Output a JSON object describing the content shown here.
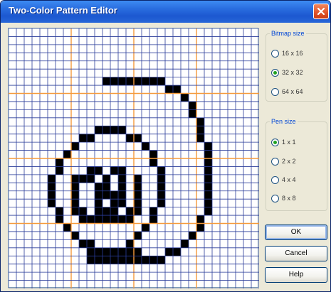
{
  "window": {
    "title": "Two-Color Pattern Editor"
  },
  "bitmap_size": {
    "label": "Bitmap size",
    "options": [
      "16 x 16",
      "32 x 32",
      "64 x 64"
    ],
    "selected": "32 x 32"
  },
  "pen_size": {
    "label": "Pen size",
    "options": [
      "1 x 1",
      "2 x 2",
      "4 x 4",
      "8 x 8"
    ],
    "selected": "1 x 1"
  },
  "buttons": {
    "ok": "OK",
    "cancel": "Cancel",
    "help": "Help"
  },
  "grid": {
    "columns": 32,
    "rows": 32,
    "line_color": "#2a3c9a",
    "guide_color": "#f59a3b",
    "guide_columns": [
      8,
      16,
      24
    ],
    "guide_rows": [
      8,
      16,
      24
    ],
    "pixel_color": "#000000",
    "background": "#ffffff",
    "filled_pixels": [
      [
        12,
        6
      ],
      [
        13,
        6
      ],
      [
        14,
        6
      ],
      [
        15,
        6
      ],
      [
        16,
        6
      ],
      [
        17,
        6
      ],
      [
        18,
        6
      ],
      [
        19,
        6
      ],
      [
        20,
        7
      ],
      [
        21,
        7
      ],
      [
        22,
        8
      ],
      [
        23,
        9
      ],
      [
        23,
        10
      ],
      [
        24,
        11
      ],
      [
        24,
        12
      ],
      [
        24,
        13
      ],
      [
        25,
        14
      ],
      [
        25,
        15
      ],
      [
        25,
        16
      ],
      [
        25,
        17
      ],
      [
        25,
        18
      ],
      [
        25,
        19
      ],
      [
        25,
        20
      ],
      [
        25,
        21
      ],
      [
        25,
        22
      ],
      [
        24,
        23
      ],
      [
        24,
        24
      ],
      [
        23,
        25
      ],
      [
        22,
        26
      ],
      [
        20,
        27
      ],
      [
        21,
        27
      ],
      [
        17,
        28
      ],
      [
        18,
        28
      ],
      [
        19,
        28
      ],
      [
        11,
        12
      ],
      [
        12,
        12
      ],
      [
        13,
        12
      ],
      [
        14,
        12
      ],
      [
        9,
        13
      ],
      [
        10,
        13
      ],
      [
        15,
        13
      ],
      [
        16,
        13
      ],
      [
        8,
        14
      ],
      [
        17,
        14
      ],
      [
        7,
        15
      ],
      [
        18,
        15
      ],
      [
        6,
        16
      ],
      [
        18,
        16
      ],
      [
        6,
        17
      ],
      [
        19,
        17
      ],
      [
        5,
        18
      ],
      [
        19,
        18
      ],
      [
        5,
        19
      ],
      [
        19,
        19
      ],
      [
        5,
        20
      ],
      [
        19,
        20
      ],
      [
        5,
        21
      ],
      [
        19,
        21
      ],
      [
        6,
        22
      ],
      [
        18,
        22
      ],
      [
        6,
        23
      ],
      [
        18,
        23
      ],
      [
        7,
        24
      ],
      [
        17,
        24
      ],
      [
        8,
        25
      ],
      [
        16,
        25
      ],
      [
        9,
        26
      ],
      [
        10,
        26
      ],
      [
        15,
        26
      ],
      [
        10,
        27
      ],
      [
        11,
        27
      ],
      [
        12,
        27
      ],
      [
        13,
        27
      ],
      [
        14,
        27
      ],
      [
        15,
        27
      ],
      [
        16,
        27
      ],
      [
        10,
        28
      ],
      [
        11,
        28
      ],
      [
        12,
        28
      ],
      [
        13,
        28
      ],
      [
        14,
        28
      ],
      [
        15,
        28
      ],
      [
        16,
        28
      ],
      [
        8,
        18
      ],
      [
        9,
        18
      ],
      [
        10,
        18
      ],
      [
        8,
        19
      ],
      [
        11,
        19
      ],
      [
        8,
        20
      ],
      [
        11,
        20
      ],
      [
        12,
        20
      ],
      [
        13,
        20
      ],
      [
        12,
        19
      ],
      [
        12,
        18
      ],
      [
        11,
        17
      ],
      [
        10,
        17
      ],
      [
        13,
        17
      ],
      [
        14,
        17
      ],
      [
        14,
        18
      ],
      [
        14,
        19
      ],
      [
        14,
        20
      ],
      [
        14,
        21
      ],
      [
        8,
        21
      ],
      [
        8,
        22
      ],
      [
        9,
        22
      ],
      [
        9,
        23
      ],
      [
        10,
        23
      ],
      [
        11,
        23
      ],
      [
        12,
        23
      ],
      [
        13,
        23
      ],
      [
        14,
        23
      ],
      [
        15,
        23
      ],
      [
        15,
        22
      ],
      [
        16,
        22
      ],
      [
        16,
        21
      ],
      [
        16,
        20
      ],
      [
        16,
        19
      ],
      [
        16,
        18
      ],
      [
        13,
        21
      ],
      [
        13,
        22
      ],
      [
        11,
        21
      ],
      [
        11,
        22
      ],
      [
        12,
        22
      ]
    ]
  }
}
